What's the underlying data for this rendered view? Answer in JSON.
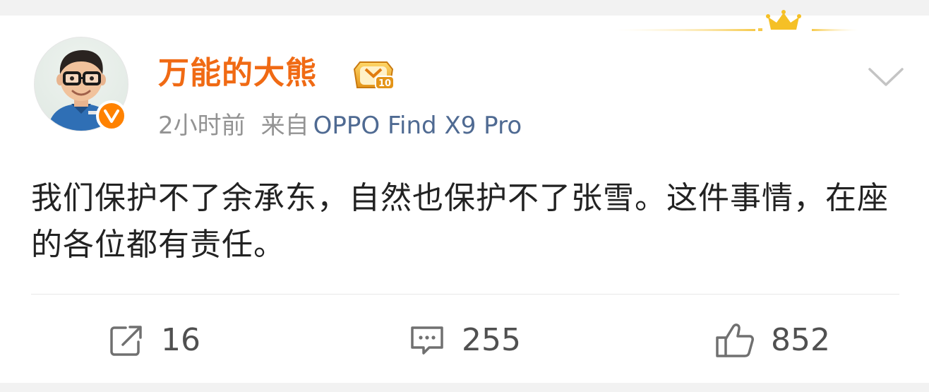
{
  "post": {
    "username": "万能的大熊",
    "time": "2小时前",
    "from_label": "来自",
    "device": "OPPO Find X9 Pro",
    "text": "我们保护不了余承东，自然也保护不了张雪。这件事情，在座的各位都有责任。"
  },
  "badges": {
    "level_number": "10"
  },
  "actions": {
    "repost_count": "16",
    "comment_count": "255",
    "like_count": "852"
  },
  "colors": {
    "username": "#f06a14",
    "device_link": "#4f6a92",
    "verified": "#ff8200",
    "meta_text": "#939393",
    "body_text": "#222222",
    "action_text": "#505050"
  },
  "icons": {
    "crown": "crown-icon",
    "verified": "verified-v-icon",
    "level": "level-badge-icon",
    "more": "chevron-down-icon",
    "repost": "repost-icon",
    "comment": "comment-icon",
    "like": "thumbs-up-icon"
  }
}
